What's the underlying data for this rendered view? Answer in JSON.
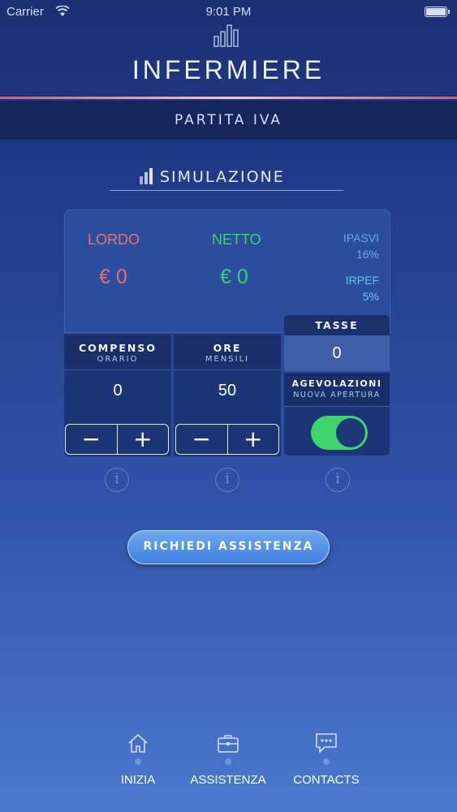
{
  "status_bar": {
    "carrier": "Carrier",
    "time": "9:01 PM"
  },
  "header": {
    "title": "INFERMIERE",
    "subtitle": "PARTITA IVA"
  },
  "section": {
    "title": "SIMULAZIONE"
  },
  "results": {
    "lordo_label": "LORDO",
    "lordo_value": "€ 0",
    "netto_label": "NETTO",
    "netto_value": "€ 0",
    "ipasvi_label": "IPASVI",
    "ipasvi_value": "16%",
    "irpef_label": "IRPEF",
    "irpef_value": "5%"
  },
  "compenso": {
    "title": "COMPENSO",
    "subtitle": "ORARIO",
    "value": "0",
    "minus": "−",
    "plus": "+"
  },
  "ore": {
    "title": "ORE",
    "subtitle": "MENSILI",
    "value": "50",
    "minus": "−",
    "plus": "+"
  },
  "tasse": {
    "title": "TASSE",
    "value": "0"
  },
  "agevolazioni": {
    "title": "AGEVOLAZIONI",
    "subtitle": "NUOVA APERTURA",
    "toggle_on": true
  },
  "info": {
    "glyph": "i"
  },
  "assist_button": "RICHIEDI ASSISTENZA",
  "tabs": [
    {
      "label": "INIZIA",
      "icon": "home-icon"
    },
    {
      "label": "ASSISTENZA",
      "icon": "briefcase-icon"
    },
    {
      "label": "CONTACTS",
      "icon": "chat-icon"
    }
  ],
  "colors": {
    "lordo": "#f06c6c",
    "netto": "#39d36b",
    "toggle": "#3dd56b",
    "accent": "#4a86e0"
  }
}
